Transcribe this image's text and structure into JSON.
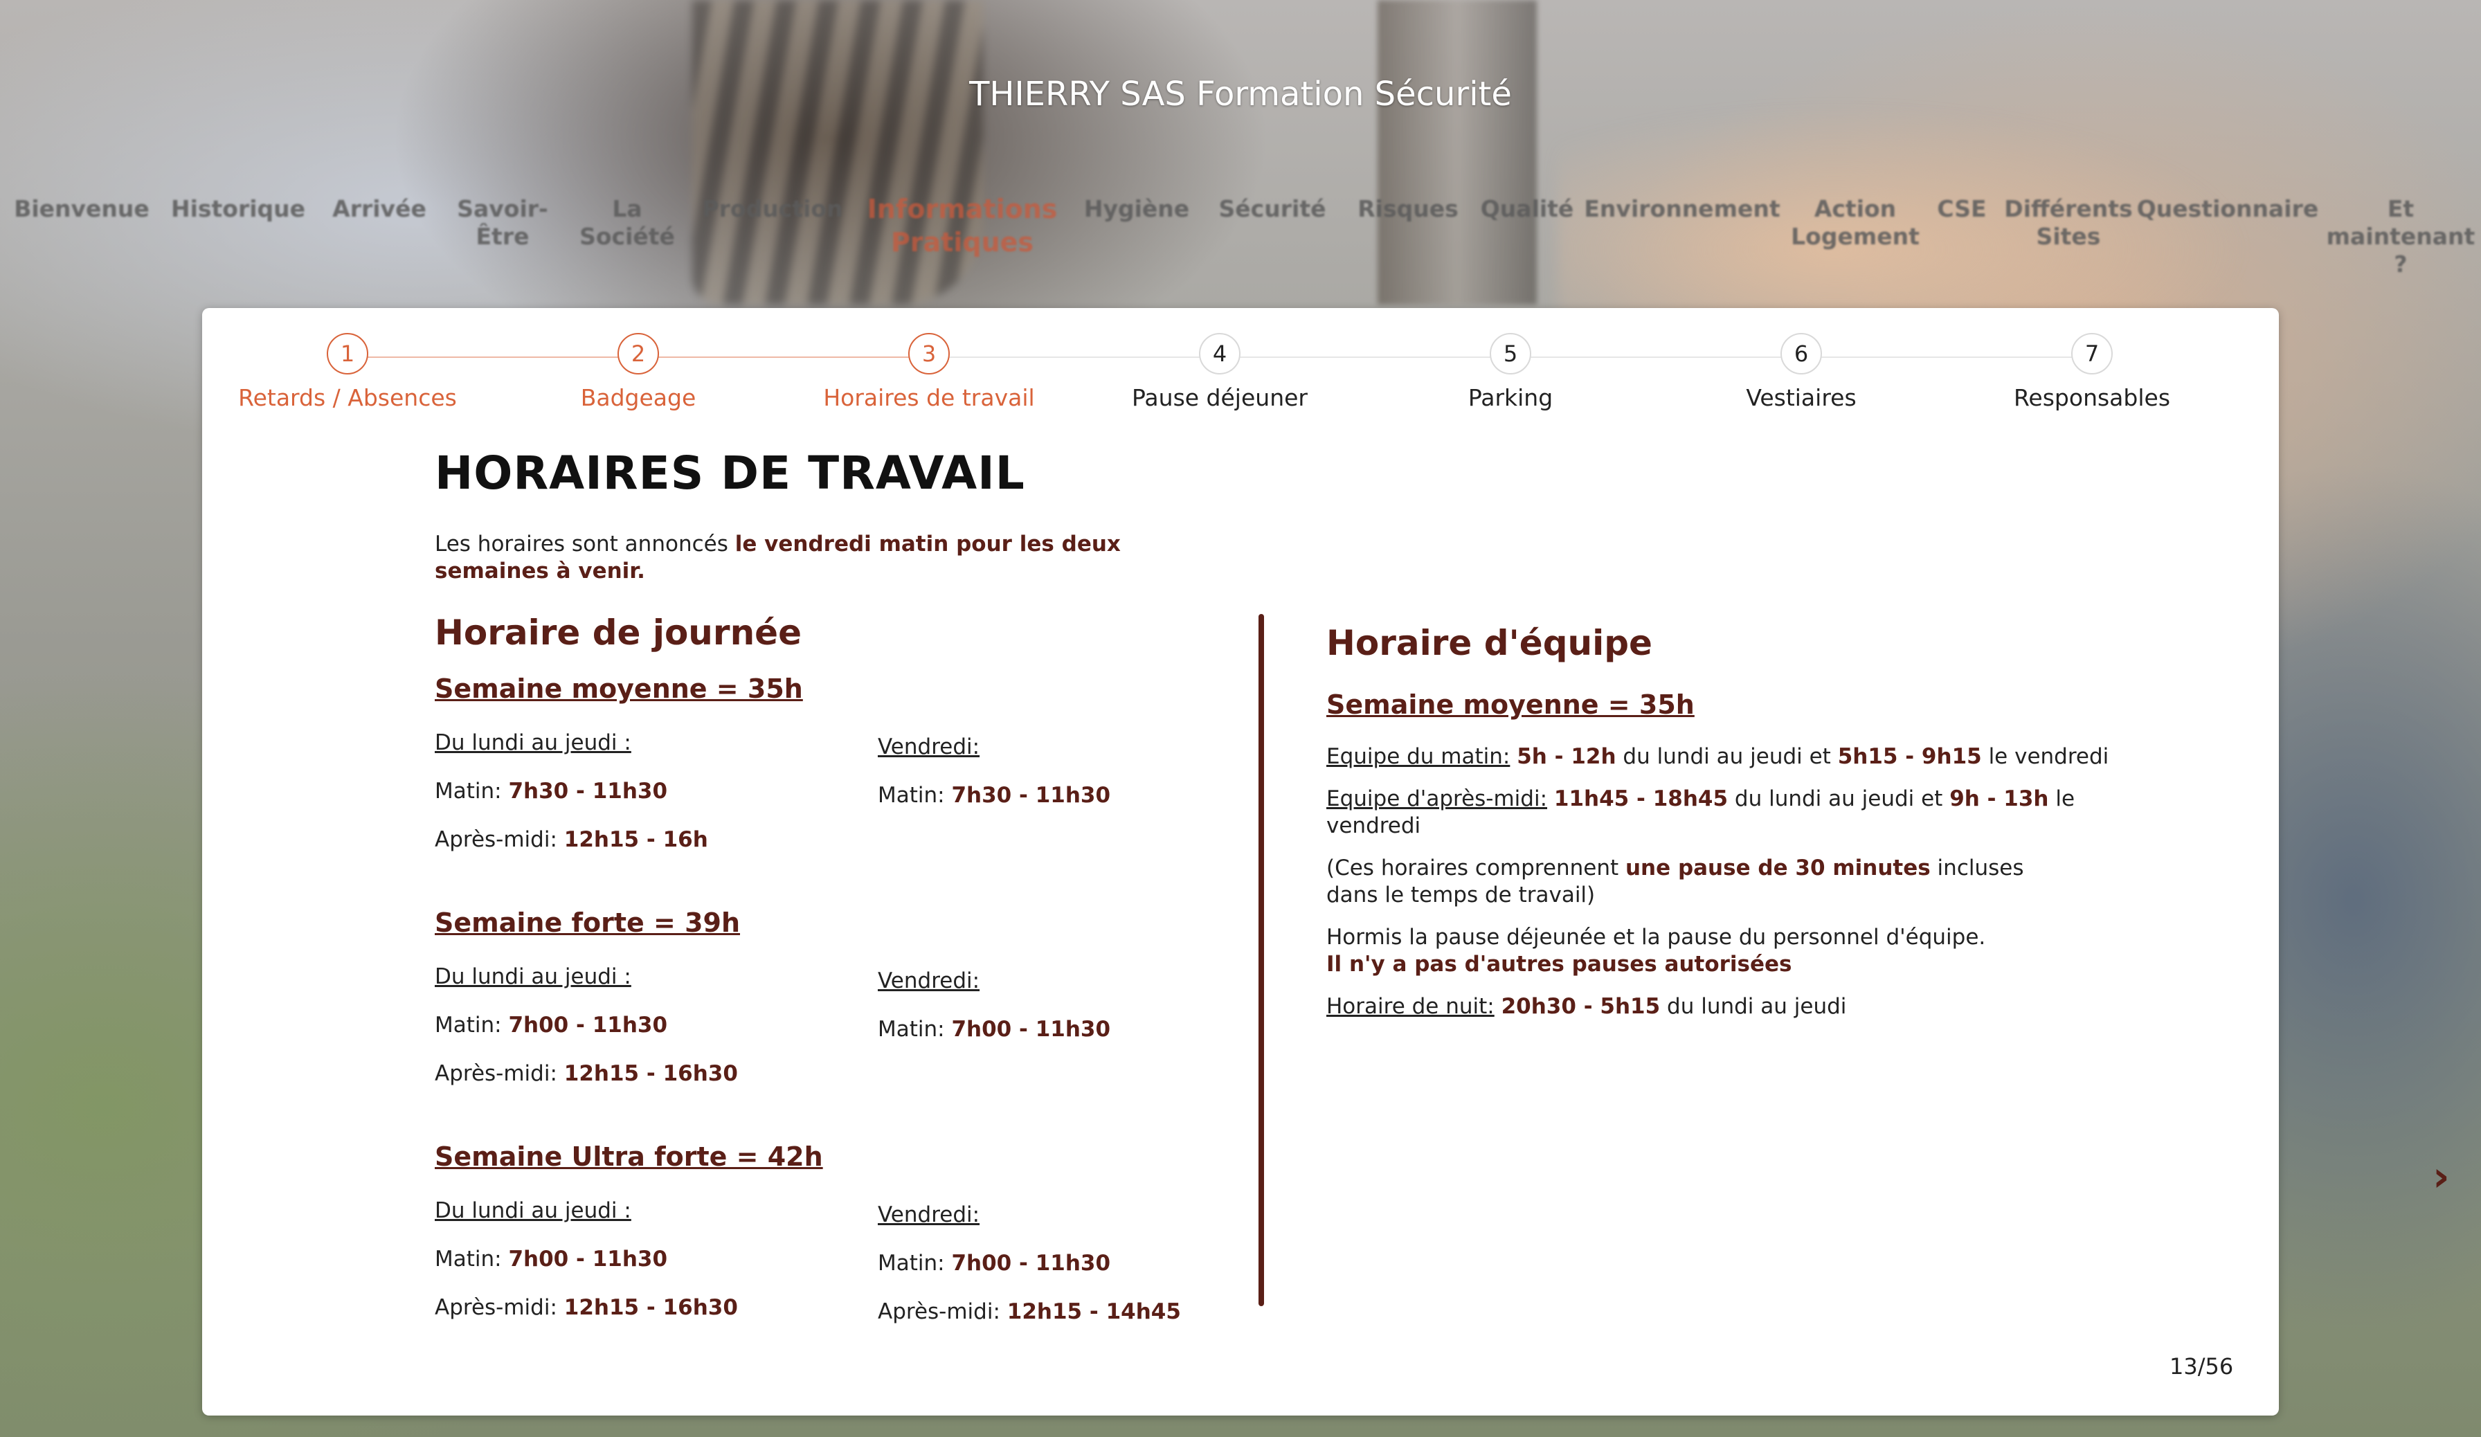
{
  "site": {
    "title": "THIERRY SAS Formation Sécurité"
  },
  "nav": [
    {
      "label": "Bienvenue"
    },
    {
      "label": "Historique"
    },
    {
      "label": "Arrivée"
    },
    {
      "label": "Savoir-\nÊtre"
    },
    {
      "label": "La\nSociété"
    },
    {
      "label": "Production"
    },
    {
      "label": "Informations\nPratiques",
      "active": true
    },
    {
      "label": "Hygiène"
    },
    {
      "label": "Sécurité"
    },
    {
      "label": "Risques"
    },
    {
      "label": "Qualité"
    },
    {
      "label": "Environnement"
    },
    {
      "label": "Action\nLogement"
    },
    {
      "label": "CSE"
    },
    {
      "label": "Différents\nSites"
    },
    {
      "label": "Questionnaire"
    },
    {
      "label": "Et\nmaintenant\n?"
    }
  ],
  "steps": [
    {
      "number": "1",
      "label": "Retards / Absences",
      "state": "done"
    },
    {
      "number": "2",
      "label": "Badgeage",
      "state": "done"
    },
    {
      "number": "3",
      "label": "Horaires de travail",
      "state": "current"
    },
    {
      "number": "4",
      "label": "Pause déjeuner",
      "state": "todo"
    },
    {
      "number": "5",
      "label": "Parking",
      "state": "todo"
    },
    {
      "number": "6",
      "label": "Vestiaires",
      "state": "todo"
    },
    {
      "number": "7",
      "label": "Responsables",
      "state": "todo"
    }
  ],
  "page": {
    "title": "HORAIRES DE TRAVAIL",
    "intro_plain": "Les horaires sont annoncés ",
    "intro_bold": "le vendredi matin pour les deux semaines à venir."
  },
  "left": {
    "heading": "Horaire de journée",
    "weeks": [
      {
        "title": "Semaine moyenne = 35h",
        "c1_day": "Du lundi au jeudi :",
        "c1_morning_label": "Matin: ",
        "c1_morning": "7h30 - 11h30",
        "c1_afternoon_label": "Après-midi: ",
        "c1_afternoon": "12h15 - 16h",
        "c2_day": "Vendredi:",
        "c2_morning_label": "Matin: ",
        "c2_morning": "7h30 - 11h30",
        "c2_afternoon_label": "",
        "c2_afternoon": ""
      },
      {
        "title": "Semaine forte = 39h",
        "c1_day": "Du lundi au jeudi :",
        "c1_morning_label": "Matin: ",
        "c1_morning": "7h00 - 11h30",
        "c1_afternoon_label": "Après-midi: ",
        "c1_afternoon": "12h15 - 16h30",
        "c2_day": "Vendredi:",
        "c2_morning_label": "Matin: ",
        "c2_morning": "7h00 - 11h30",
        "c2_afternoon_label": "",
        "c2_afternoon": ""
      },
      {
        "title": "Semaine Ultra forte = 42h",
        "c1_day": "Du lundi au jeudi :",
        "c1_morning_label": "Matin: ",
        "c1_morning": "7h00 - 11h30",
        "c1_afternoon_label": "Après-midi: ",
        "c1_afternoon": "12h15 - 16h30",
        "c2_day": "Vendredi:",
        "c2_morning_label": "Matin: ",
        "c2_morning": "7h00 - 11h30",
        "c2_afternoon_label": "Après-midi: ",
        "c2_afternoon": "12h15 - 14h45"
      }
    ]
  },
  "right": {
    "heading": "Horaire d'équipe",
    "week_title": "Semaine moyenne = 35h",
    "morning_team": {
      "label": "Equipe du matin:",
      "t1": "5h - 12h",
      "mid": " du lundi au jeudi et ",
      "t2": "5h15 - 9h15",
      "end": " le vendredi"
    },
    "afternoon_team": {
      "label": "Equipe d'après-midi:",
      "t1": "11h45 - 18h45",
      "mid": " du lundi au jeudi et ",
      "t2": "9h - 13h",
      "end": " le vendredi"
    },
    "pause_note": {
      "p1": "(Ces horaires comprennent ",
      "bold": "une pause de 30 minutes",
      "p2": " incluses dans le temps de travail)"
    },
    "other_pauses": {
      "plain": "Hormis la pause déjeunée et la pause du personnel d'équipe.",
      "bold": "Il n'y a pas d'autres pauses autorisées"
    },
    "night": {
      "label": "Horaire de nuit:",
      "time": "20h30 - 5h15",
      "end": " du lundi au jeudi"
    }
  },
  "nav_next": {
    "glyph": "›"
  },
  "counter": "13/56",
  "colors": {
    "accent": "#d9633a",
    "brand": "#5a1f17"
  }
}
